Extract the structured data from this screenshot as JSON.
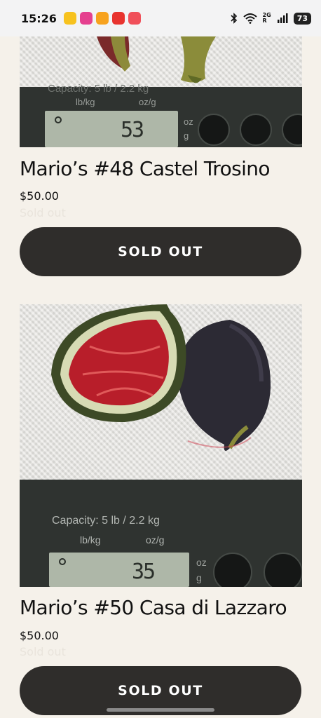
{
  "status_bar": {
    "time": "15:26",
    "network_label": "2G",
    "network_sub": "R",
    "battery": "73",
    "app_icon_colors": [
      "#f7c21e",
      "#e5408f",
      "#f7a21e",
      "#e8332e",
      "#f0505a"
    ]
  },
  "products": [
    {
      "title": "Mario’s #48 Castel Trosino",
      "price": "$50.00",
      "sold_note": "Sold out",
      "button_label": "SOLD OUT",
      "image": {
        "scale_capacity": "Capacity: 5 lb / 2.2 kg",
        "unit_left": "lb/kg",
        "unit_right": "oz/g",
        "reading": "53",
        "unit_oz": "oz",
        "unit_g": "g"
      }
    },
    {
      "title": "Mario’s #50 Casa di Lazzaro",
      "price": "$50.00",
      "sold_note": "Sold out",
      "button_label": "SOLD OUT",
      "image": {
        "scale_capacity": "Capacity: 5 lb / 2.2 kg",
        "unit_left": "lb/kg",
        "unit_right": "oz/g",
        "reading": "35",
        "unit_oz": "oz",
        "unit_g": "g"
      }
    }
  ],
  "colors": {
    "page_background": "#f5f1ea",
    "button_background": "#2f2d2b",
    "button_text": "#ffffff"
  }
}
